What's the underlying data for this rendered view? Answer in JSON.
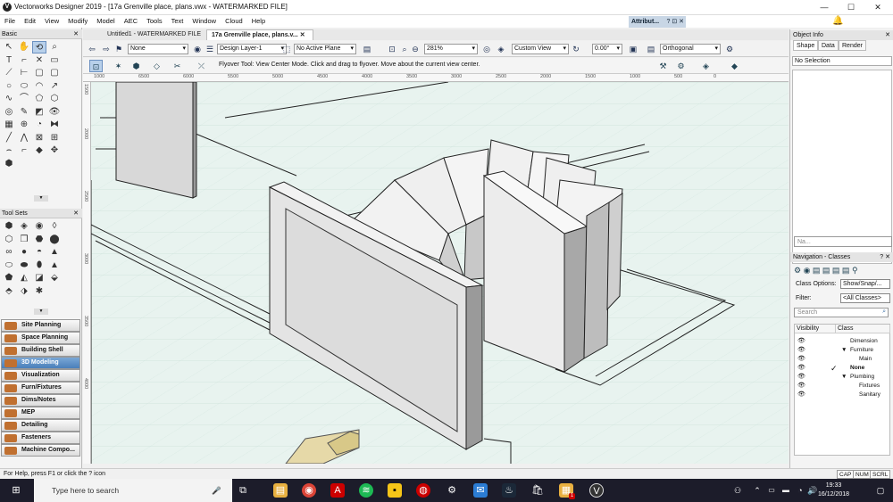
{
  "window": {
    "title": "Vectorworks Designer 2019 - [17a Grenville place, plans.vwx - WATERMARKED FILE]",
    "app_icon": "V"
  },
  "window_controls": {
    "minimize": "—",
    "maximize": "☐",
    "close": "✕"
  },
  "menu": [
    "File",
    "Edit",
    "View",
    "Modify",
    "Model",
    "AEC",
    "Tools",
    "Text",
    "Window",
    "Cloud",
    "Help"
  ],
  "attributes_palette": {
    "title": "Attribut...",
    "controls": "? ⊡ ✕"
  },
  "basic_palette": {
    "title": "Basic",
    "close": "✕"
  },
  "tool_sets_palette": {
    "title": "Tool Sets",
    "close": "✕"
  },
  "tool_sets": [
    "Site Planning",
    "Space Planning",
    "Building Shell",
    "3D Modeling",
    "Visualization",
    "Furn/Fixtures",
    "Dims/Notes",
    "MEP",
    "Detailing",
    "Fasteners",
    "Machine Compo..."
  ],
  "active_tool_set": "3D Modeling",
  "doc_tabs": [
    "Untitled1 - WATERMARKED FILE ✕",
    "17a Grenville place, plans.v... ✕"
  ],
  "view_bar": {
    "class": "None",
    "layer": "Design Layer-1",
    "plane": "No Active Plane",
    "zoom": "281%",
    "view": "Custom View",
    "angle": "0.00°",
    "projection": "Orthogonal"
  },
  "mode_bar": {
    "help": "Flyover Tool: View Center Mode. Click and drag to flyover.  Move about the current view center."
  },
  "h_ruler": [
    "1000",
    "6500",
    "6000",
    "5500",
    "5000",
    "4500",
    "4000",
    "3500",
    "3000",
    "2500",
    "2000",
    "1500",
    "1000",
    "500",
    "0"
  ],
  "v_ruler": [
    "1500",
    "2000",
    "2500",
    "3000",
    "3500",
    "4000"
  ],
  "status": {
    "help": "For Help, press F1 or click the ? icon",
    "caps": "CAP",
    "num": "NUM",
    "scrl": "SCRL"
  },
  "object_info": {
    "title": "Object Info",
    "close": "✕",
    "tabs": [
      "Shape",
      "Data",
      "Render"
    ],
    "selection": "No Selection",
    "name_placeholder": "Na..."
  },
  "navigation": {
    "title": "Navigation - Classes",
    "class_options_label": "Class Options:",
    "class_options_value": "Show/Snap/...",
    "filter_label": "Filter:",
    "filter_value": "<All Classes>",
    "search_placeholder": "Search",
    "col_visibility": "Visibility",
    "col_class": "Class",
    "classes": [
      {
        "name": "Dimension",
        "indent": 0,
        "marker": "",
        "bold": false
      },
      {
        "name": "Furniture",
        "indent": 0,
        "marker": "▼",
        "bold": false
      },
      {
        "name": "Main",
        "indent": 1,
        "marker": "",
        "bold": false
      },
      {
        "name": "None",
        "indent": 0,
        "marker": "",
        "bold": true,
        "active": "✓"
      },
      {
        "name": "Plumbing",
        "indent": 0,
        "marker": "▼",
        "bold": false
      },
      {
        "name": "Fixtures",
        "indent": 1,
        "marker": "",
        "bold": false
      },
      {
        "name": "Sanitary",
        "indent": 1,
        "marker": "",
        "bold": false
      }
    ]
  },
  "taskbar": {
    "search_placeholder": "Type here to search",
    "time": "19:33",
    "date": "16/12/2018",
    "badge": "1"
  },
  "colors": {
    "canvas": "#e8f3ef",
    "accent": "#4a7fba",
    "taskbar": "#1c1c2a"
  }
}
